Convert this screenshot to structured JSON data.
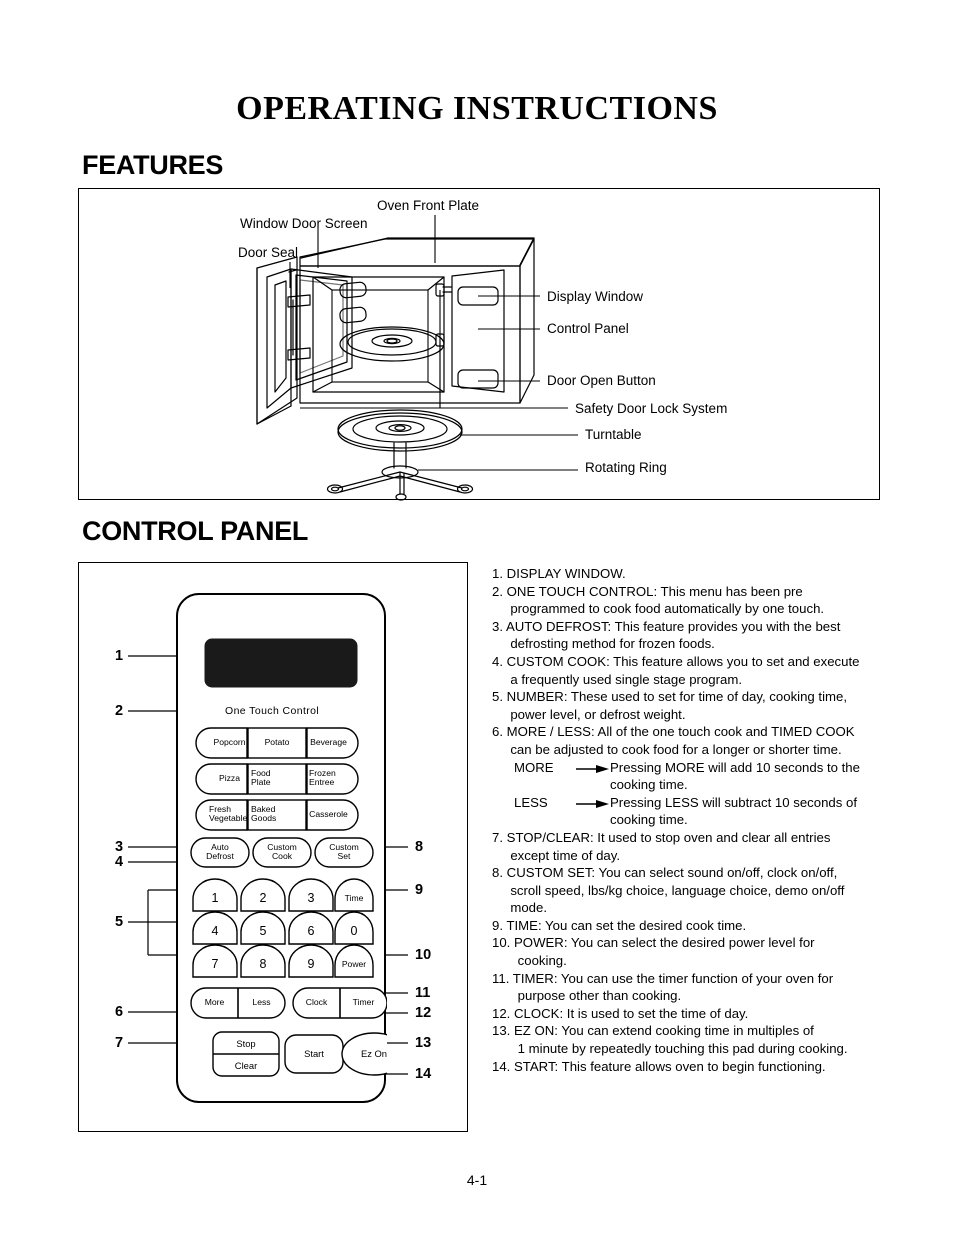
{
  "page": {
    "title": "OPERATING INSTRUCTIONS",
    "number": "4-1"
  },
  "sections": {
    "features": {
      "heading": "FEATURES"
    },
    "control_panel": {
      "heading": "CONTROL PANEL"
    }
  },
  "features_diagram": {
    "labels": [
      {
        "text": "Oven Front Plate"
      },
      {
        "text": "Window Door Screen"
      },
      {
        "text": "Door Seal"
      },
      {
        "text": "Display Window"
      },
      {
        "text": "Control Panel"
      },
      {
        "text": "Door Open Button"
      },
      {
        "text": "Safety Door Lock System"
      },
      {
        "text": "Turntable"
      },
      {
        "text": "Rotating Ring"
      }
    ]
  },
  "control_panel_diagram": {
    "one_touch_title": "One Touch Control",
    "one_touch_buttons": [
      "Popcorn",
      "Potato",
      "Beverage",
      "Pizza",
      "Food\nPlate",
      "Frozen\nEntree",
      "Fresh\nVegetable",
      "Baked\nGoods",
      "Casserole"
    ],
    "function_buttons": [
      "Auto\nDefrost",
      "Custom\nCook",
      "Custom\nSet"
    ],
    "keypad": [
      [
        "1",
        "2",
        "3",
        "Time"
      ],
      [
        "4",
        "5",
        "6",
        "0"
      ],
      [
        "7",
        "8",
        "9",
        "Power"
      ]
    ],
    "pair_buttons": [
      "More",
      "Less",
      "Clock",
      "Timer"
    ],
    "action_buttons": [
      "Stop",
      "Clear",
      "Start",
      "Ez On"
    ],
    "callouts_left": [
      "1",
      "2",
      "3",
      "4",
      "5",
      "6",
      "7"
    ],
    "callouts_right": [
      "8",
      "9",
      "10",
      "11",
      "12",
      "13",
      "14"
    ]
  },
  "descriptions": [
    {
      "n": "1.",
      "text": "DISPLAY WINDOW."
    },
    {
      "n": "2.",
      "text": "ONE TOUCH CONTROL: This menu has been pre\n     programmed to cook food automatically by one touch."
    },
    {
      "n": "3.",
      "text": "AUTO DEFROST: This feature provides you with the best\n     defrosting method for frozen foods."
    },
    {
      "n": "4.",
      "text": "CUSTOM COOK: This feature allows you to set and execute\n     a frequently used single stage program."
    },
    {
      "n": "5.",
      "text": "NUMBER: These used to set for time of day, cooking time,\n     power level, or defrost weight."
    },
    {
      "n": "6.",
      "text": "MORE / LESS: All of the one touch cook and TIMED COOK\n     can be adjusted to cook food for a longer or shorter time."
    }
  ],
  "more_less": {
    "more_tag": "MORE",
    "more_text": "Pressing MORE will add 10 seconds to the",
    "more_text2": "cooking time.",
    "less_tag": "LESS",
    "less_text": "Pressing LESS will subtract 10 seconds of",
    "less_text2": "cooking time."
  },
  "descriptions_cont": [
    {
      "n": "7.",
      "text": "STOP/CLEAR: It used to stop oven and clear all entries\n     except time of day."
    },
    {
      "n": "8.",
      "text": "CUSTOM SET: You can select sound on/off, clock on/off,\n     scroll speed, lbs/kg choice, language choice, demo on/off\n     mode."
    },
    {
      "n": "9.",
      "text": "TIME: You can set the desired cook time."
    },
    {
      "n": "10.",
      "text": "POWER: You can select the desired power level for\n       cooking."
    },
    {
      "n": "11.",
      "text": "TIMER: You can use the timer function of your oven for\n       purpose other than cooking."
    },
    {
      "n": "12.",
      "text": "CLOCK: It is used to set the time of day."
    },
    {
      "n": "13.",
      "text": "EZ ON: You can extend cooking time in multiples of\n       1 minute by repeatedly touching this pad during cooking."
    },
    {
      "n": "14.",
      "text": "START: This feature allows oven to begin functioning."
    }
  ],
  "colors": {
    "ink": "#000000",
    "page_bg": "#ffffff",
    "display_window": "#1a1a1a"
  }
}
